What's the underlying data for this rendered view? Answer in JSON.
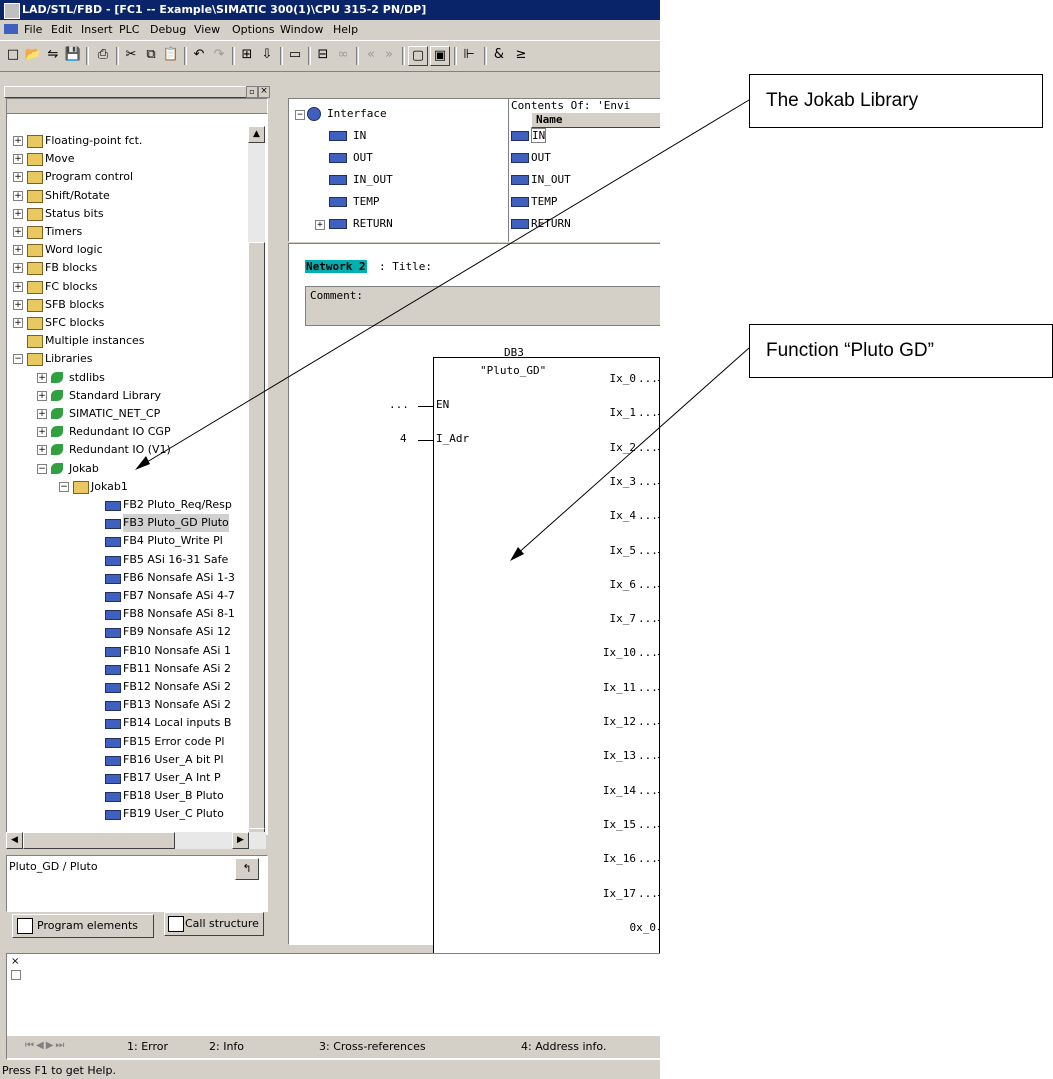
{
  "window": {
    "title": "LAD/STL/FBD  - [FC1 -- Example\\SIMATIC 300(1)\\CPU 315-2 PN/DP]"
  },
  "menu": [
    "File",
    "Edit",
    "Insert",
    "PLC",
    "Debug",
    "View",
    "Options",
    "Window",
    "Help"
  ],
  "tree": [
    {
      "label": "Floating-point fct.",
      "level": 0,
      "exp": "+",
      "icon": "folder"
    },
    {
      "label": "Move",
      "level": 0,
      "exp": "+",
      "icon": "folder"
    },
    {
      "label": "Program control",
      "level": 0,
      "exp": "+",
      "icon": "folder"
    },
    {
      "label": "Shift/Rotate",
      "level": 0,
      "exp": "+",
      "icon": "folder"
    },
    {
      "label": "Status bits",
      "level": 0,
      "exp": "+",
      "icon": "folder"
    },
    {
      "label": "Timers",
      "level": 0,
      "exp": "+",
      "icon": "folder"
    },
    {
      "label": "Word logic",
      "level": 0,
      "exp": "+",
      "icon": "folder"
    },
    {
      "label": "FB blocks",
      "level": 0,
      "exp": "+",
      "icon": "folder"
    },
    {
      "label": "FC blocks",
      "level": 0,
      "exp": "+",
      "icon": "folder"
    },
    {
      "label": "SFB blocks",
      "level": 0,
      "exp": "+",
      "icon": "folder"
    },
    {
      "label": "SFC blocks",
      "level": 0,
      "exp": "+",
      "icon": "folder"
    },
    {
      "label": "Multiple instances",
      "level": 0,
      "exp": "",
      "icon": "folder"
    },
    {
      "label": "Libraries",
      "level": 0,
      "exp": "-",
      "icon": "folder"
    },
    {
      "label": "stdlibs",
      "level": 1,
      "exp": "+",
      "icon": "lib"
    },
    {
      "label": "Standard Library",
      "level": 1,
      "exp": "+",
      "icon": "lib"
    },
    {
      "label": "SIMATIC_NET_CP",
      "level": 1,
      "exp": "+",
      "icon": "lib"
    },
    {
      "label": "Redundant IO CGP",
      "level": 1,
      "exp": "+",
      "icon": "lib"
    },
    {
      "label": "Redundant IO (V1)",
      "level": 1,
      "exp": "+",
      "icon": "lib"
    },
    {
      "label": "Jokab",
      "level": 1,
      "exp": "-",
      "icon": "lib"
    },
    {
      "label": "Jokab1",
      "level": 2,
      "exp": "-",
      "icon": "folder"
    },
    {
      "label": "FB2  Pluto_Req/Resp",
      "level": 3,
      "exp": "",
      "icon": "fb"
    },
    {
      "label": "FB3  Pluto_GD  Pluto",
      "level": 3,
      "exp": "",
      "icon": "fb",
      "selected": true
    },
    {
      "label": "FB4  Pluto_Write  Pl",
      "level": 3,
      "exp": "",
      "icon": "fb"
    },
    {
      "label": "FB5  ASi 16-31 Safe",
      "level": 3,
      "exp": "",
      "icon": "fb"
    },
    {
      "label": "FB6  Nonsafe ASi 1-3",
      "level": 3,
      "exp": "",
      "icon": "fb"
    },
    {
      "label": "FB7  Nonsafe ASi 4-7",
      "level": 3,
      "exp": "",
      "icon": "fb"
    },
    {
      "label": "FB8  Nonsafe ASi 8-1",
      "level": 3,
      "exp": "",
      "icon": "fb"
    },
    {
      "label": "FB9  Nonsafe ASi 12",
      "level": 3,
      "exp": "",
      "icon": "fb"
    },
    {
      "label": "FB10  Nonsafe ASi 1",
      "level": 3,
      "exp": "",
      "icon": "fb"
    },
    {
      "label": "FB11  Nonsafe ASi 2",
      "level": 3,
      "exp": "",
      "icon": "fb"
    },
    {
      "label": "FB12  Nonsafe ASi 2",
      "level": 3,
      "exp": "",
      "icon": "fb"
    },
    {
      "label": "FB13  Nonsafe ASi 2",
      "level": 3,
      "exp": "",
      "icon": "fb"
    },
    {
      "label": "FB14  Local inputs B",
      "level": 3,
      "exp": "",
      "icon": "fb"
    },
    {
      "label": "FB15  Error code  Pl",
      "level": 3,
      "exp": "",
      "icon": "fb"
    },
    {
      "label": "FB16  User_A bit  Pl",
      "level": 3,
      "exp": "",
      "icon": "fb"
    },
    {
      "label": "FB17  User_A Int  P",
      "level": 3,
      "exp": "",
      "icon": "fb"
    },
    {
      "label": "FB18  User_B  Pluto",
      "level": 3,
      "exp": "",
      "icon": "fb"
    },
    {
      "label": "FB19  User_C  Pluto",
      "level": 3,
      "exp": "",
      "icon": "fb"
    }
  ],
  "info_text": "Pluto_GD / Pluto",
  "left_tabs": {
    "program_elements": "Program elements",
    "call_structure": "Call structure"
  },
  "interface": {
    "root": "Interface",
    "items": [
      "IN",
      "OUT",
      "IN_OUT",
      "TEMP",
      "RETURN"
    ]
  },
  "contents": {
    "header": "Contents Of: 'Envi",
    "col": "Name",
    "items": [
      "IN",
      "OUT",
      "IN_OUT",
      "TEMP",
      "RETURN"
    ]
  },
  "network": {
    "label": "Network 2",
    "title": ": Title:",
    "comment": "Comment:"
  },
  "block": {
    "db": "DB3",
    "name": "\"Pluto_GD\"",
    "inputs": [
      {
        "pin": "EN",
        "value": "..."
      },
      {
        "pin": "I_Adr",
        "value": "4"
      }
    ],
    "outputs": [
      "Ix_0",
      "Ix_1",
      "Ix_2",
      "Ix_3",
      "Ix_4",
      "Ix_5",
      "Ix_6",
      "Ix_7",
      "Ix_10",
      "Ix_11",
      "Ix_12",
      "Ix_13",
      "Ix_14",
      "Ix_15",
      "Ix_16",
      "Ix_17",
      "0x_0"
    ],
    "out_value": "..."
  },
  "bottom_tabs": [
    "1: Error",
    "2: Info",
    "3: Cross-references",
    "4: Address info."
  ],
  "status": "Press F1 to get Help.",
  "callouts": {
    "library": "The Jokab Library",
    "function": "Function “Pluto  GD”"
  }
}
